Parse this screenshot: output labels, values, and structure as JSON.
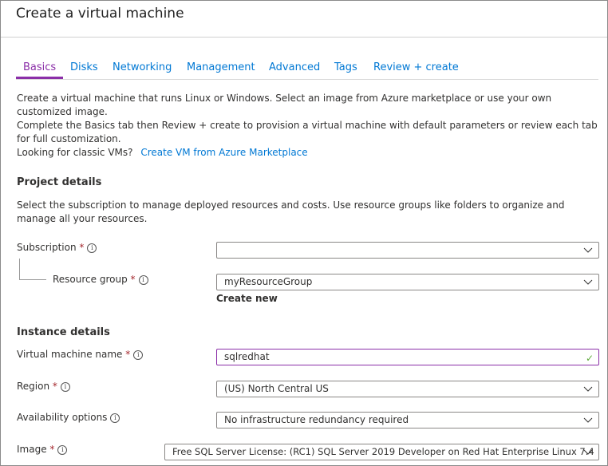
{
  "window": {
    "title": "Create a virtual machine"
  },
  "tabs": [
    {
      "label": "Basics",
      "active": true
    },
    {
      "label": "Disks"
    },
    {
      "label": "Networking"
    },
    {
      "label": "Management"
    },
    {
      "label": "Advanced"
    },
    {
      "label": "Tags"
    },
    {
      "label": "Review + create"
    }
  ],
  "intro": {
    "line1": "Create a virtual machine that runs Linux or Windows. Select an image from Azure marketplace or use your own customized image.",
    "line2": "Complete the Basics tab then Review + create to provision a virtual machine with default parameters or review each tab for full customization.",
    "classic_prefix": "Looking for classic VMs?",
    "classic_link": "Create VM from Azure Marketplace"
  },
  "project": {
    "heading": "Project details",
    "description": "Select the subscription to manage deployed resources and costs. Use resource groups like folders to organize and manage all your resources.",
    "subscription": {
      "label": "Subscription",
      "value": ""
    },
    "resource_group": {
      "label": "Resource group",
      "value": "myResourceGroup",
      "create_new": "Create new"
    }
  },
  "instance": {
    "heading": "Instance details",
    "vm_name": {
      "label": "Virtual machine name",
      "value": "sqlredhat"
    },
    "region": {
      "label": "Region",
      "value": "(US) North Central US"
    },
    "availability": {
      "label": "Availability options",
      "value": "No infrastructure redundancy required"
    },
    "image": {
      "label": "Image",
      "value": "Free SQL Server License: (RC1) SQL Server 2019 Developer on Red Hat Enterprise Linux 7.4"
    }
  },
  "common": {
    "required_mark": "*",
    "info_glyph": "i"
  },
  "colors": {
    "accent": "#8b2fa8",
    "link": "#0078d4",
    "required": "#a4262c",
    "valid": "#5fab3c"
  }
}
